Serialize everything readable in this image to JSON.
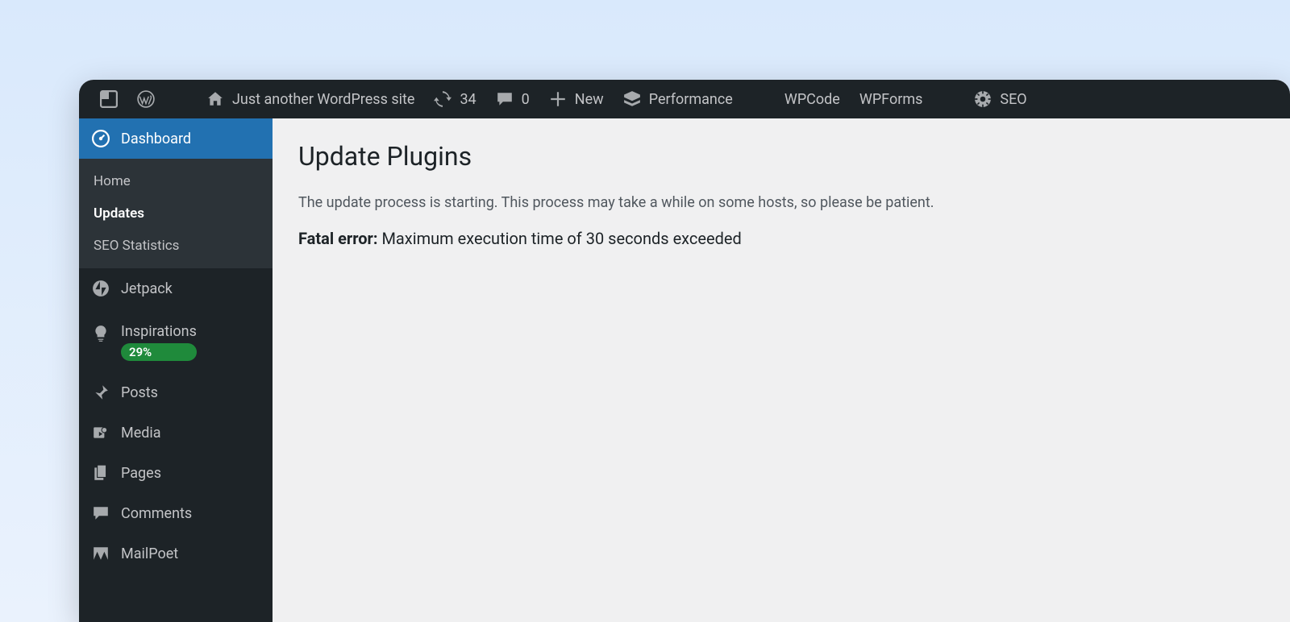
{
  "adminbar": {
    "site_name": "Just another WordPress site",
    "updates_count": "34",
    "comments_count": "0",
    "new_label": "New",
    "performance_label": "Performance",
    "wpcode_label": "WPCode",
    "wpforms_label": "WPForms",
    "seo_label": "SEO"
  },
  "sidebar": {
    "dashboard": {
      "label": "Dashboard"
    },
    "submenu": {
      "home": "Home",
      "updates": "Updates",
      "seo_stats": "SEO Statistics"
    },
    "jetpack": {
      "label": "Jetpack"
    },
    "inspirations": {
      "label": "Inspirations",
      "badge": "29%"
    },
    "posts": {
      "label": "Posts"
    },
    "media": {
      "label": "Media"
    },
    "pages": {
      "label": "Pages"
    },
    "comments": {
      "label": "Comments"
    },
    "mailpoet": {
      "label": "MailPoet"
    }
  },
  "main": {
    "title": "Update Plugins",
    "starting_text": "The update process is starting. This process may take a while on some hosts, so please be patient.",
    "error_label": "Fatal error:",
    "error_message": " Maximum execution time of 30 seconds exceeded"
  }
}
